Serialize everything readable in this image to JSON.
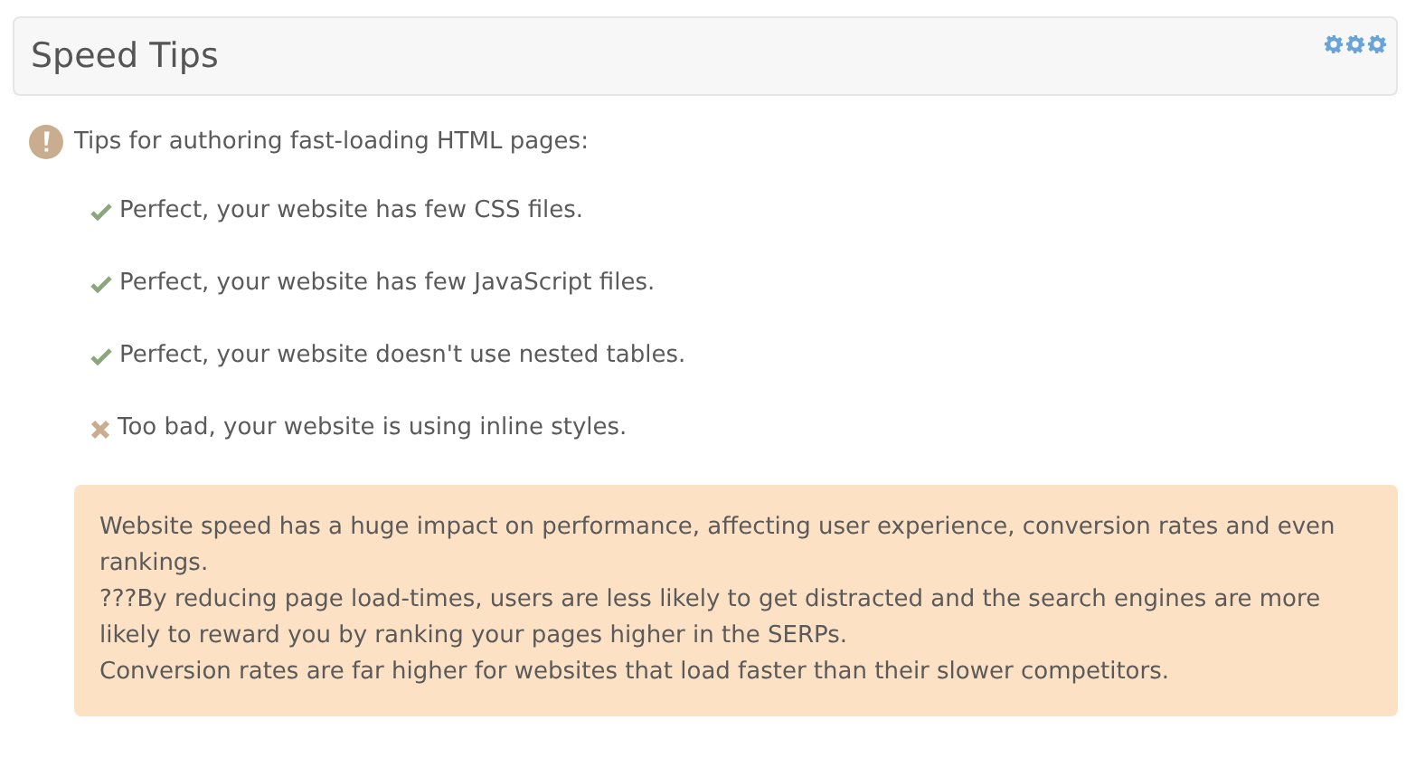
{
  "panel": {
    "title": "Speed Tips"
  },
  "intro": "Tips for authoring fast-loading HTML pages:",
  "tips": [
    {
      "kind": "pass",
      "text": "Perfect, your website has few CSS files."
    },
    {
      "kind": "pass",
      "text": "Perfect, your website has few JavaScript files."
    },
    {
      "kind": "pass",
      "text": "Perfect, your website doesn't use nested tables."
    },
    {
      "kind": "fail",
      "text": "Too bad, your website is using inline styles."
    }
  ],
  "note": [
    "Website speed has a huge impact on performance, affecting user experience, conversion rates and even rankings.",
    "???By reducing page load-times, users are less likely to get distracted and the search engines are more likely to reward you by ranking your pages higher in the SERPs.",
    "Conversion rates are far higher for websites that load faster than their slower competitors."
  ]
}
